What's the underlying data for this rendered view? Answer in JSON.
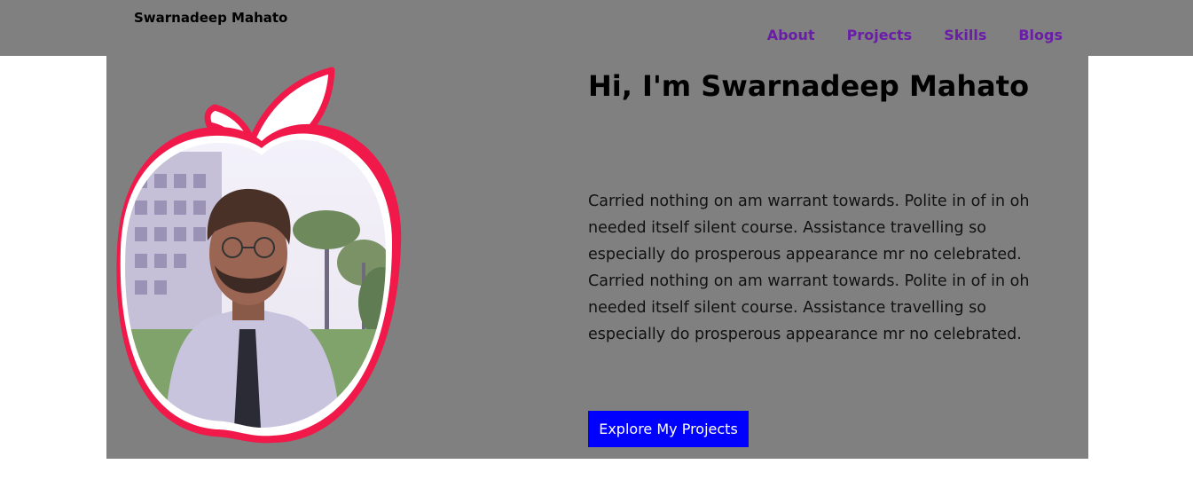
{
  "navbar": {
    "brand": "Swarnadeep Mahato",
    "links": [
      "About",
      "Projects",
      "Skills",
      "Blogs"
    ]
  },
  "hero": {
    "headline": "Hi, I'm Swarnadeep Mahato",
    "bio": "Carried nothing on am warrant towards. Polite in of in oh needed itself silent course. Assistance travelling so especially do prosperous appearance mr no celebrated. Carried nothing on am warrant towards. Polite in of in oh needed itself silent course. Assistance travelling so especially do prosperous appearance mr no celebrated.",
    "cta_label": "Explore My Projects",
    "photo_icon": "person-portrait"
  },
  "colors": {
    "navbar_bg": "#808080",
    "hero_bg": "#808080",
    "nav_link": "#6a1ea8",
    "apple_outline": "#f0194a",
    "cta_bg": "#0000ff",
    "cta_text": "#ffffff"
  }
}
